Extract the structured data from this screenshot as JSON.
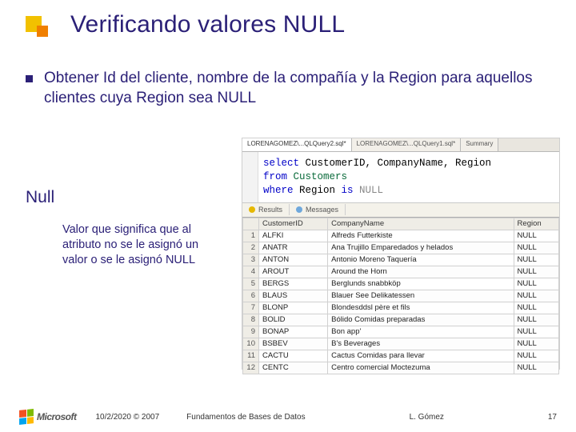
{
  "title": "Verificando valores NULL",
  "bullet": "Obtener Id del cliente, nombre de la compañía y la Region para aquellos clientes cuya Region sea NULL",
  "null_heading": "Null",
  "null_def": "Valor que significa que al atributo no se le asignó un valor o se le asignó NULL",
  "editor": {
    "tabs": [
      "LORENAGOMEZ\\...QLQuery2.sql*",
      "LORENAGOMEZ\\...QLQuery1.sql*",
      "Summary"
    ],
    "sql": {
      "line1": {
        "kw": "select",
        "rest": " CustomerID, CompanyName, Region"
      },
      "line2": {
        "kw": "from",
        "tk": " Customers"
      },
      "line3": {
        "kw1": "where",
        "mid": " Region ",
        "kw2": "is",
        "val": " NULL"
      }
    },
    "result_tabs": {
      "results": "Results",
      "messages": "Messages"
    },
    "columns": [
      "",
      "CustomerID",
      "CompanyName",
      "Region"
    ],
    "rows": [
      [
        "1",
        "ALFKI",
        "Alfreds Futterkiste",
        "NULL"
      ],
      [
        "2",
        "ANATR",
        "Ana Trujillo Emparedados y helados",
        "NULL"
      ],
      [
        "3",
        "ANTON",
        "Antonio Moreno Taquería",
        "NULL"
      ],
      [
        "4",
        "AROUT",
        "Around the Horn",
        "NULL"
      ],
      [
        "5",
        "BERGS",
        "Berglunds snabbköp",
        "NULL"
      ],
      [
        "6",
        "BLAUS",
        "Blauer See Delikatessen",
        "NULL"
      ],
      [
        "7",
        "BLONP",
        "Blondesddsl père et fils",
        "NULL"
      ],
      [
        "8",
        "BOLID",
        "Bólido Comidas preparadas",
        "NULL"
      ],
      [
        "9",
        "BONAP",
        "Bon app'",
        "NULL"
      ],
      [
        "10",
        "BSBEV",
        "B's Beverages",
        "NULL"
      ],
      [
        "11",
        "CACTU",
        "Cactus Comidas para llevar",
        "NULL"
      ],
      [
        "12",
        "CENTC",
        "Centro comercial Moctezuma",
        "NULL"
      ]
    ]
  },
  "footer": {
    "logo_text": "Microsoft",
    "date": "10/2/2020 © 2007",
    "course": "Fundamentos de Bases de Datos",
    "author": "L. Gómez",
    "page": "17"
  }
}
